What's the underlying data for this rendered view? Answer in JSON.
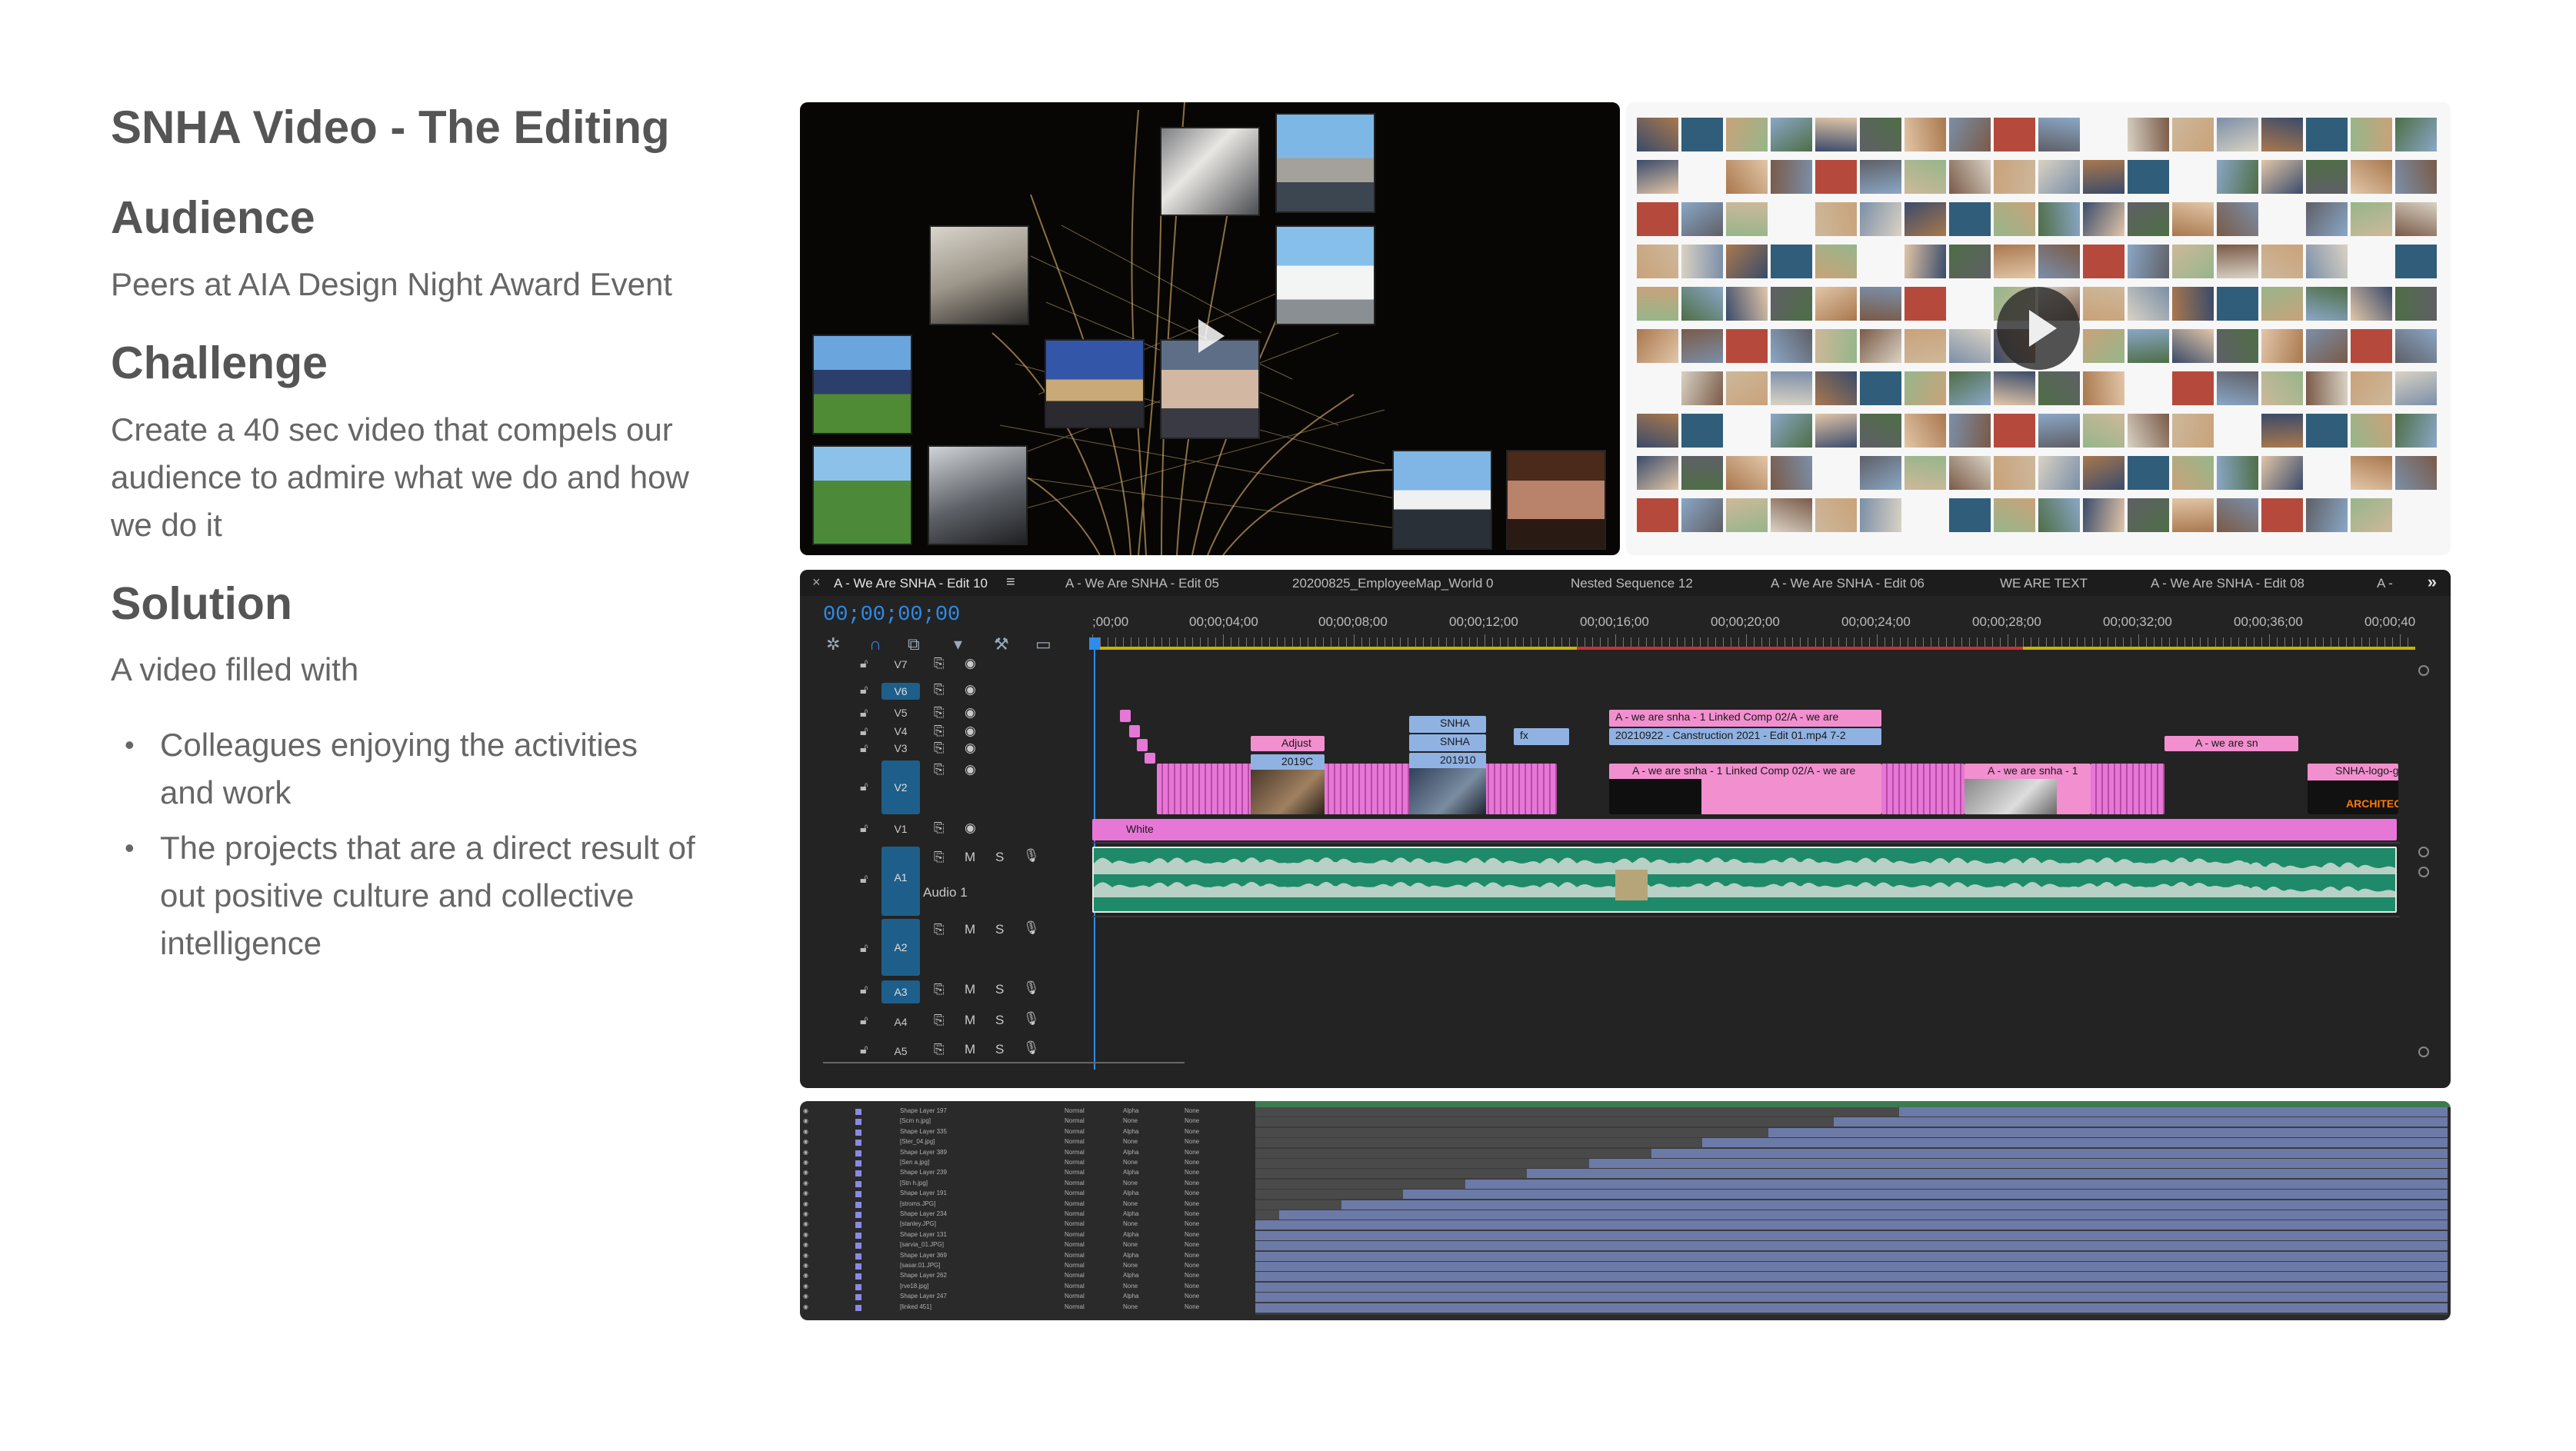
{
  "slide": {
    "title": "SNHA Video - The Editing",
    "audience_heading": "Audience",
    "audience_body": "Peers at AIA Design Night Award Event",
    "challenge_heading": "Challenge",
    "challenge_body": "Create a 40 sec video that compels our audience to admire what we do and how we do it",
    "solution_heading": "Solution",
    "solution_body": "A video filled with",
    "bullets": [
      "Colleagues enjoying the activities and work",
      "The projects that are a direct result of out positive culture and collective intelligence"
    ]
  },
  "timeline": {
    "tabs": [
      "A - We Are SNHA - Edit 10",
      "A - We Are SNHA - Edit 05",
      "20200825_EmployeeMap_World 0",
      "Nested Sequence 12",
      "A - We Are SNHA - Edit 06",
      "WE ARE TEXT",
      "A - We Are SNHA - Edit 08",
      "A -"
    ],
    "timecode": "00;00;00;00",
    "ruler": [
      ";00;00",
      "00;00;04;00",
      "00;00;08;00",
      "00;00;12;00",
      "00;00;16;00",
      "00;00;20;00",
      "00;00;24;00",
      "00;00;28;00",
      "00;00;32;00",
      "00;00;36;00",
      "00;00;40"
    ],
    "video_tracks": [
      "V7",
      "V6",
      "V5",
      "V4",
      "V3",
      "V2",
      "V1"
    ],
    "audio_tracks": [
      "A1",
      "A2",
      "A3",
      "A4",
      "A5"
    ],
    "audio_track_name": "Audio 1",
    "ctrl_m": "M",
    "ctrl_s": "S",
    "clips": {
      "v4_linked": "A - we are snha - 1 Linked Comp 02/A - we are",
      "v3_construction": "20210922 - Canstruction 2021 - Edit 01.mp4 7-2",
      "v2_linked": "A - we are snha - 1 Linked Comp 02/A - we are",
      "v2_snha1": "A - we are snha - 1",
      "v3_snha_short": "A - we are sn",
      "v2_logo": "SNHA-logo-gra",
      "adjust": "Adjust",
      "c2019": "2019C",
      "snha_a": "SNHA",
      "snha_b": "SNHA",
      "c201910": "201910",
      "white": "White",
      "architects": "ARCHITECTS",
      "fx": "fx"
    }
  },
  "layers": {
    "names": [
      "Shape Layer 197",
      "[Scm n.jpg]",
      "Shape Layer 335",
      "[Ster_04.jpg]",
      "Shape Layer 389",
      "[Sen a.jpg]",
      "Shape Layer 239",
      "[Stn h.jpg]",
      "Shape Layer 191",
      "[stroms.JPG]",
      "Shape Layer 234",
      "[stanley.JPG]",
      "Shape Layer 131",
      "[sarvia_01.JPG]",
      "Shape Layer 369",
      "[sasar.01.JPG]",
      "Shape Layer 262",
      "[rve18.jpg]",
      "Shape Layer 247",
      "[linked 451]"
    ],
    "mode": "Normal",
    "track_matte": [
      "Alpha",
      "None"
    ],
    "parent": "None"
  },
  "colors": {
    "timecode_blue": "#2d8ceb",
    "clip_pink": "#e777d6",
    "clip_blue": "#8fb2e3",
    "audio_green": "#1e8a6a",
    "layer_bar": "#6c7aa8"
  }
}
